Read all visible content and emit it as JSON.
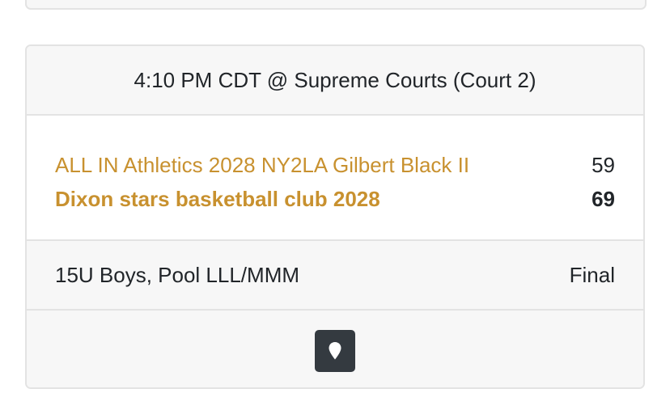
{
  "game": {
    "time_venue": "4:10 PM CDT @ Supreme Courts (Court 2)",
    "teams": [
      {
        "name": "ALL IN Athletics 2028 NY2LA Gilbert Black II",
        "score": "59",
        "winner": false
      },
      {
        "name": "Dixon stars basketball club 2028",
        "score": "69",
        "winner": true
      }
    ],
    "division": "15U Boys, Pool LLL/MMM",
    "status": "Final",
    "map_icon": "map-marker-icon"
  },
  "colors": {
    "team_link": "#c8912f",
    "header_bg": "#f7f7f7",
    "border": "#e3e3e3",
    "button_bg": "#343a40"
  }
}
